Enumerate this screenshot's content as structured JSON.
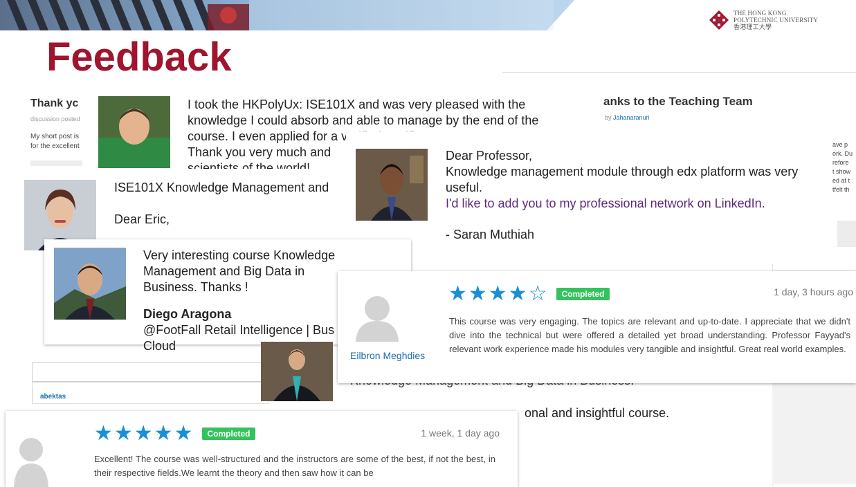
{
  "header": {
    "title": "Feedback",
    "university": {
      "name_line1": "The Hong Kong",
      "name_line2": "Polytechnic University",
      "name_chinese": "香港理工大學"
    }
  },
  "colors": {
    "title": "#a0152e",
    "star": "#1a8fd6",
    "badge": "#34c25d",
    "link": "#1a6fb0",
    "linkedin_purple": "#5b2a7c"
  },
  "bg_post_left": {
    "title": "Thank yc",
    "meta": "discussion posted",
    "line1": "My short post is",
    "line2": "for the excellent"
  },
  "bg_post_right": {
    "title": "anks to the Teaching Team",
    "by": "by",
    "author": "Jahanaranuri",
    "snippet_lines": [
      "ave p",
      "ork. Du",
      "refore",
      "t show",
      "ed at t",
      "tfelt th"
    ]
  },
  "bg_post_bottom": {
    "user": "abektas",
    "text": "onal and insightful course."
  },
  "card_hkpolyux": {
    "line1": "I took the HKPolyUx: ISE101X and was very pleased with the",
    "line2": "knowledge I could absorb and able to manage by the end of the",
    "line3": "course. I even applied for a verified certificate.",
    "line4": "Thank you very much and",
    "line5": "scientists of the world!"
  },
  "card_saran": {
    "line1": "Dear Professor,",
    "line2": "Knowledge management module through edx platform was very",
    "line3": "useful.",
    "line4": "I'd like to add you to my professional network on LinkedIn.",
    "line5": "- Saran Muthiah"
  },
  "card_eric": {
    "line1": "ISE101X Knowledge Management and",
    "line2": "Dear Eric,"
  },
  "card_diego": {
    "line1": "Very interesting course Knowledge Management and Big Data in",
    "line2": "Business. Thanks !",
    "name": "Diego Aragona",
    "line3": "@FootFall Retail Intelligence | Bus",
    "line4": "Cloud"
  },
  "review_eilbron": {
    "rating": 4,
    "stars": "★★★★☆",
    "status": "Completed",
    "time": "1 day, 3 hours ago",
    "reviewer": "Eilbron Meghdies",
    "text": "This course was very engaging. The topics are relevant and up-to-date. I appreciate that we didn't dive into the technical but were offered a detailed yet broad understanding. Professor Fayyad's relevant work experience made his modules very tangible and insightful. Great real world examples."
  },
  "review_bottom": {
    "rating": 5,
    "stars": "★★★★★",
    "status": "Completed",
    "time": "1 week, 1 day ago",
    "text": "Excellent! The course was well-structured and the instructors are some of the best, if not the best, in their respective fields.We learnt the theory and then saw how it can be"
  },
  "bg_behind_photo": {
    "text": "Knowledge Management and Big Data in Business."
  }
}
